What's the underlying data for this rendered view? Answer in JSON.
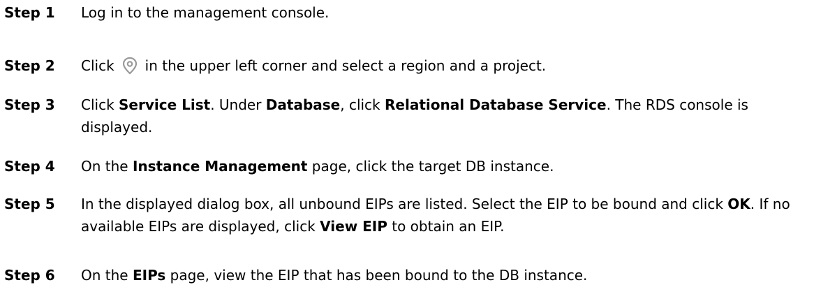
{
  "steps": [
    {
      "label": "Step 1",
      "parts": [
        "Log in to the management console."
      ]
    },
    {
      "label": "Step 2",
      "parts": [
        "Click",
        "in the upper left corner and select a region and a project."
      ],
      "icon": "location-pin-icon"
    },
    {
      "label": "Step 3",
      "parts": [
        "Click ",
        "Service List",
        ". Under ",
        "Database",
        ", click ",
        "Relational Database Service",
        ". The RDS console is displayed."
      ]
    },
    {
      "label": "Step 4",
      "parts": [
        "On the ",
        "Instance Management",
        " page, click the target DB instance."
      ]
    },
    {
      "label": "Step 5",
      "parts": [
        "In the displayed dialog box, all unbound EIPs are listed. Select the EIP to be bound and click ",
        "OK",
        ". If no available EIPs are displayed, click ",
        "View EIP",
        " to obtain an EIP."
      ]
    },
    {
      "label": "Step 6",
      "parts": [
        "On the ",
        "EIPs",
        " page, view the EIP that has been bound to the DB instance."
      ]
    }
  ]
}
